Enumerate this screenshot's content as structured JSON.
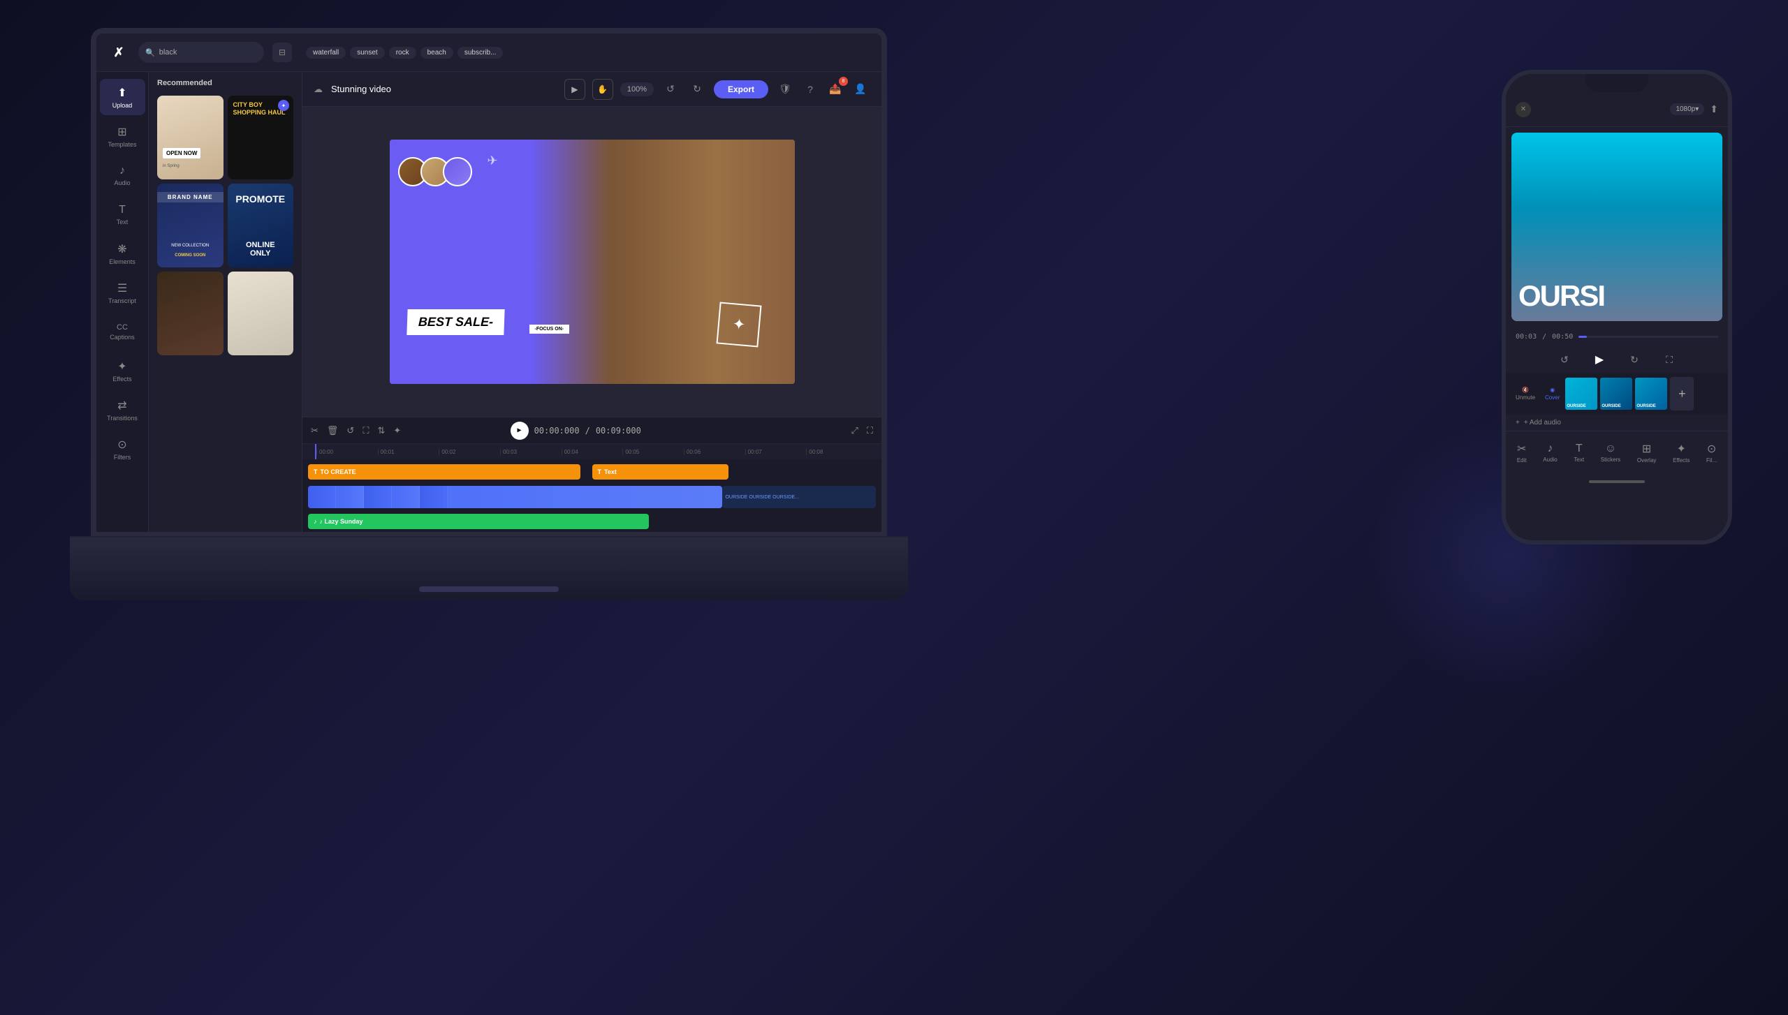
{
  "app": {
    "title": "Stunning video",
    "logo": "✗",
    "export_label": "Export",
    "zoom": "100%",
    "undo_label": "↺",
    "redo_label": "↻"
  },
  "search": {
    "placeholder": "black",
    "value": "black"
  },
  "tags": [
    "waterfall",
    "sunset",
    "rock",
    "beach",
    "subscrib..."
  ],
  "sidebar": {
    "items": [
      {
        "id": "upload",
        "label": "Upload",
        "icon": "⬆",
        "active": true
      },
      {
        "id": "templates",
        "label": "Templates",
        "icon": "⊞"
      },
      {
        "id": "audio",
        "label": "Audio",
        "icon": "♪"
      },
      {
        "id": "text",
        "label": "Text",
        "icon": "T"
      },
      {
        "id": "elements",
        "label": "Elements",
        "icon": "❋"
      },
      {
        "id": "transcript",
        "label": "Transcript",
        "icon": "☰"
      },
      {
        "id": "captions",
        "label": "Captions",
        "icon": "CC"
      },
      {
        "id": "effects",
        "label": "Effects",
        "icon": "✦"
      },
      {
        "id": "transitions",
        "label": "Transitions",
        "icon": "⇄"
      },
      {
        "id": "filters",
        "label": "Filters",
        "icon": "⊙"
      }
    ]
  },
  "panel": {
    "section_title": "Recommended",
    "templates": [
      {
        "id": "tc1",
        "label": "OPEN NOW",
        "type": "beige"
      },
      {
        "id": "tc2",
        "label": "CITY BOY\nSHOPPING HAUL",
        "type": "dark"
      },
      {
        "id": "tc3",
        "label": "BRAND NAME\nNEW COLLECTION\nCOMING SOON",
        "type": "brand"
      },
      {
        "id": "tc4",
        "label": "PROMOTE\nONLINE ONLY",
        "type": "promo"
      },
      {
        "id": "tc5",
        "label": "",
        "type": "brown"
      },
      {
        "id": "tc6",
        "label": "",
        "type": "food"
      }
    ]
  },
  "canvas": {
    "sale_text": "BEST SALE-",
    "focus_text": "-FOCUS ON-",
    "send_icon": "✈"
  },
  "timeline": {
    "current_time": "00:00:000",
    "total_time": "00:09:000",
    "markers": [
      "00:00",
      "00:01",
      "00:02",
      "00:03",
      "00:04",
      "00:05",
      "00:06",
      "00:07",
      "00:08"
    ],
    "clips": [
      {
        "id": "clip1",
        "label": "TO CREATE",
        "type": "orange",
        "track": "text1"
      },
      {
        "id": "clip2",
        "label": "Text",
        "type": "orange",
        "track": "text2"
      },
      {
        "id": "clip3",
        "label": "",
        "type": "video",
        "track": "video"
      },
      {
        "id": "clip4",
        "label": "OURSIDE OURSIDE OURSIDE...",
        "type": "dark",
        "track": "video"
      },
      {
        "id": "clip5",
        "label": "♪ Lazy Sunday",
        "type": "audio",
        "track": "audio"
      }
    ]
  },
  "phone": {
    "resolution": "1080p▾",
    "canvas_text": "OURSI",
    "time_current": "00:03",
    "time_total": "00:50",
    "add_audio": "+ Add audio",
    "bottom_nav": [
      {
        "label": "Edit",
        "icon": "✂",
        "active": false
      },
      {
        "label": "Audio",
        "icon": "♪",
        "active": false
      },
      {
        "label": "Text",
        "icon": "T",
        "active": false
      },
      {
        "label": "Stickers",
        "icon": "☺",
        "active": false
      },
      {
        "label": "Overlay",
        "icon": "⊞",
        "active": false
      },
      {
        "label": "Effects",
        "icon": "✦",
        "active": false
      },
      {
        "label": "Fil...",
        "icon": "⊙",
        "active": false
      }
    ],
    "strip_label": "OURSIDE OURSIDE OURSIDE",
    "unmute": "Unmute",
    "cover": "Cover"
  },
  "icons": {
    "search": "🔍",
    "filter": "⊟",
    "play": "▶",
    "pause": "⏸",
    "cut": "✂",
    "delete": "🗑",
    "loop": "↺",
    "crop": "⛶",
    "flip": "⇅",
    "magic": "✦",
    "resize": "⤢",
    "fullscreen": "⛶",
    "undo": "↺",
    "redo": "↻",
    "shield": "🛡",
    "help": "?",
    "share": "📤",
    "notification_count": "8",
    "avatar": "👤"
  },
  "colors": {
    "accent": "#5b5ef4",
    "orange": "#f5920a",
    "green": "#22c55e",
    "canvas_purple": "#6b5ce7"
  }
}
